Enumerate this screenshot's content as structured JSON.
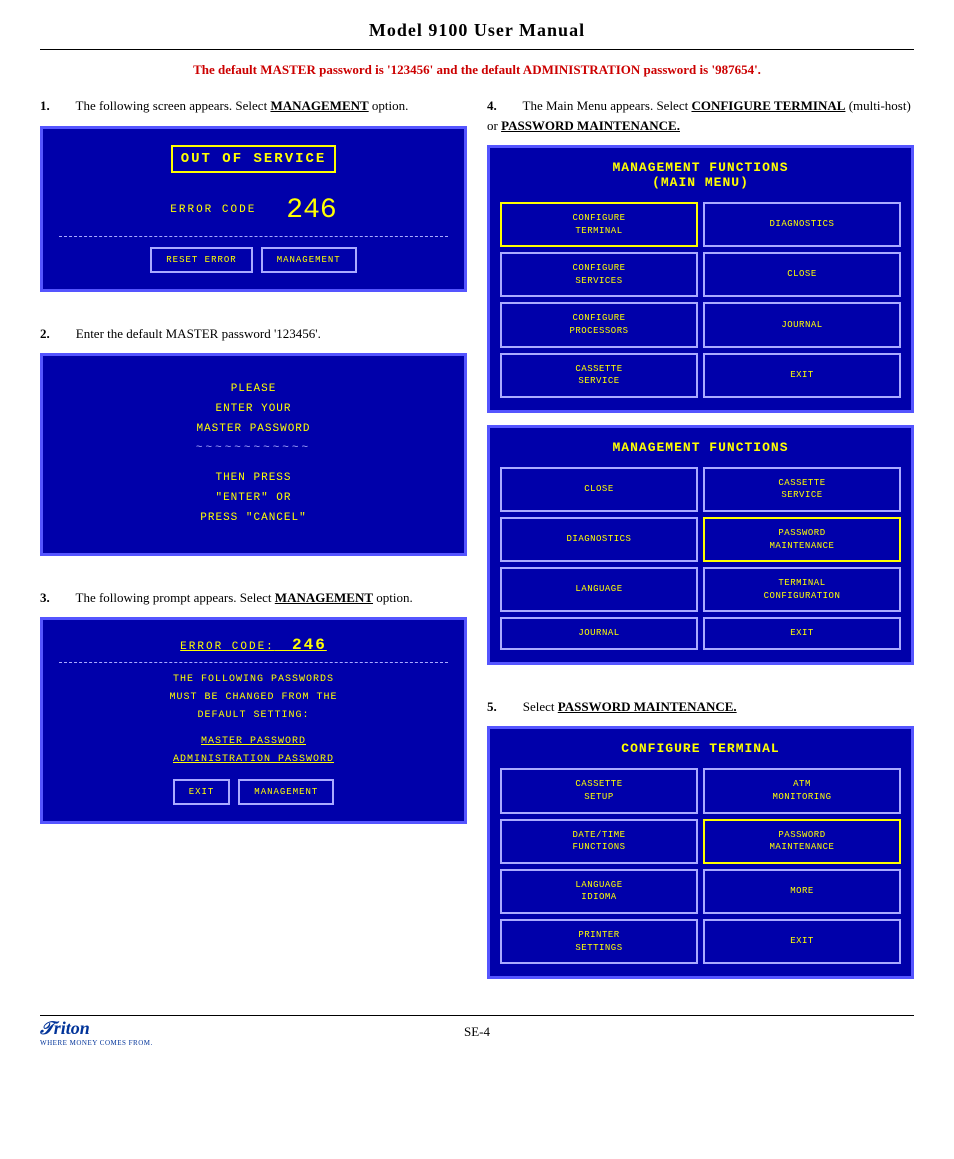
{
  "header": {
    "title": "Model 9100 User Manual"
  },
  "notice": {
    "text": "The default MASTER password is '123456' and the default ADMINISTRATION password is '987654'."
  },
  "sections": {
    "s1": {
      "number": "1.",
      "text": "The following screen appears.  Select MANAGEMENT option."
    },
    "s2": {
      "number": "2.",
      "text": "Enter the default MASTER password '123456'."
    },
    "s3": {
      "number": "3.",
      "text": "The following prompt appears.  Select MANAGEMENT option."
    },
    "s4": {
      "number": "4.",
      "text": "The Main Menu appears.  Select CONFIGURE TERMINAL (multi-host) or PASSWORD MAINTENANCE."
    },
    "s5": {
      "number": "5.",
      "text": "Select PASSWORD MAINTENANCE."
    }
  },
  "screen1": {
    "title": "OUT OF SERVICE",
    "error_label": "ERROR CODE",
    "error_number": "246",
    "btn1": "RESET ERROR",
    "btn2": "MANAGEMENT"
  },
  "screen2": {
    "line1": "PLEASE",
    "line2": "ENTER YOUR",
    "line3": "MASTER PASSWORD",
    "dashes": "~~~~~~~~~~~~",
    "line4": "THEN PRESS",
    "line5": "\"ENTER\" OR",
    "line6": "PRESS \"CANCEL\""
  },
  "screen3": {
    "error_label": "ERROR CODE:",
    "error_number": "246",
    "line1": "THE FOLLOWING PASSWORDS",
    "line2": "MUST BE CHANGED FROM THE",
    "line3": "DEFAULT SETTING:",
    "pw1": "MASTER PASSWORD",
    "pw2": "ADMINISTRATION PASSWORD",
    "btn1": "EXIT",
    "btn2": "MANAGEMENT"
  },
  "menu1": {
    "title": "MANAGEMENT FUNCTIONS\n(MAIN MENU)",
    "btns": [
      {
        "label": "CONFIGURE\nTERMINAL",
        "highlight": true
      },
      {
        "label": "DIAGNOSTICS",
        "highlight": false
      },
      {
        "label": "CONFIGURE\nSERVICES",
        "highlight": false
      },
      {
        "label": "CLOSE",
        "highlight": false
      },
      {
        "label": "CONFIGURE\nPROCESSORS",
        "highlight": false
      },
      {
        "label": "JOURNAL",
        "highlight": false
      },
      {
        "label": "CASSETTE\nSERVICE",
        "highlight": false
      },
      {
        "label": "EXIT",
        "highlight": false
      }
    ]
  },
  "menu2": {
    "title": "MANAGEMENT FUNCTIONS",
    "btns": [
      {
        "label": "CLOSE",
        "highlight": false
      },
      {
        "label": "CASSETTE\nSERVICE",
        "highlight": false
      },
      {
        "label": "DIAGNOSTICS",
        "highlight": false
      },
      {
        "label": "PASSWORD\nMAINTENANCE",
        "highlight": true
      },
      {
        "label": "LANGUAGE",
        "highlight": false
      },
      {
        "label": "TERMINAL\nCONFIGURATION",
        "highlight": false
      },
      {
        "label": "JOURNAL",
        "highlight": false
      },
      {
        "label": "EXIT",
        "highlight": false
      }
    ]
  },
  "menu3": {
    "title": "CONFIGURE TERMINAL",
    "btns": [
      {
        "label": "CASSETTE\nSETUP",
        "highlight": false
      },
      {
        "label": "ATM\nMONITORING",
        "highlight": false
      },
      {
        "label": "DATE/TIME\nFUNCTIONS",
        "highlight": false
      },
      {
        "label": "PASSWORD\nMAINTENANCE",
        "highlight": true
      },
      {
        "label": "LANGUAGE\nIDIOMA",
        "highlight": false
      },
      {
        "label": "MORE",
        "highlight": false
      },
      {
        "label": "PRINTER\nSETTINGS",
        "highlight": false
      },
      {
        "label": "EXIT",
        "highlight": false
      }
    ]
  },
  "footer": {
    "logo": "Triton",
    "tagline": "WHERE MONEY COMES FROM.",
    "page": "SE-4"
  }
}
